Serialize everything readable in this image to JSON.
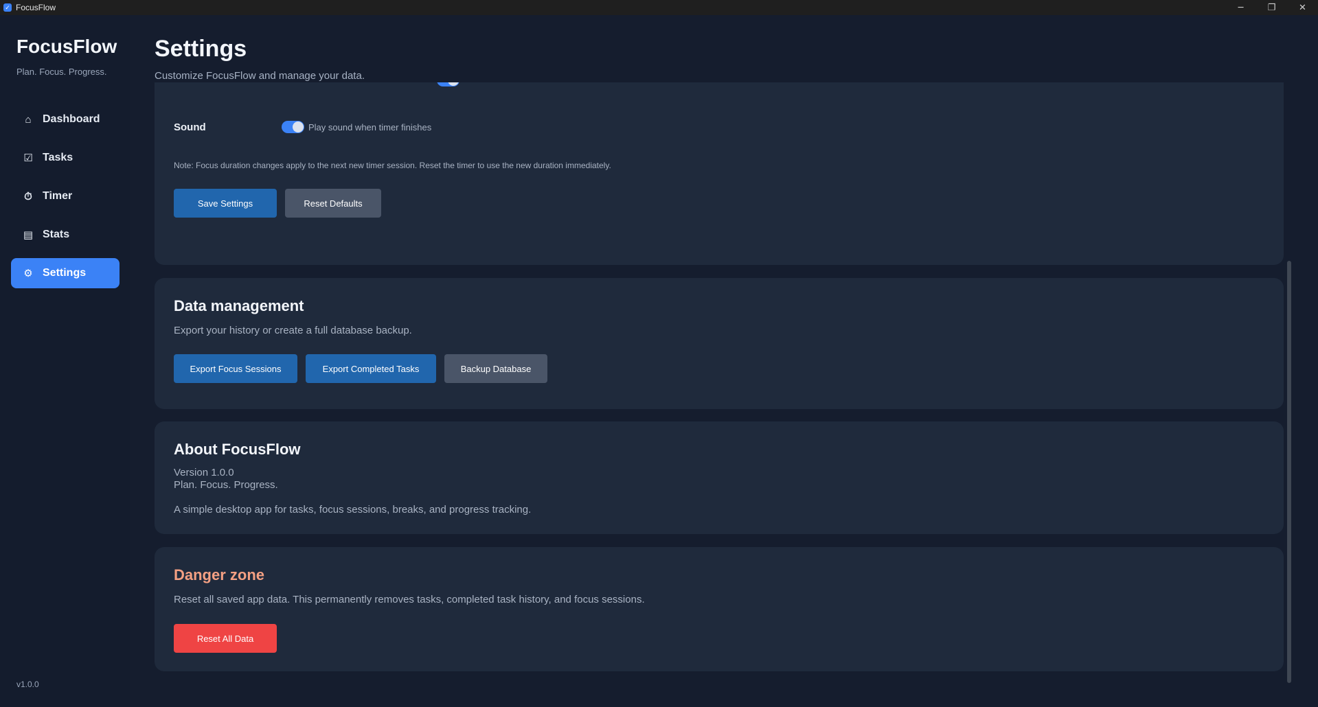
{
  "window": {
    "title": "FocusFlow",
    "controls": {
      "minimize": "─",
      "maximize": "❐",
      "close": "✕"
    }
  },
  "sidebar": {
    "brand": "FocusFlow",
    "tagline": "Plan. Focus. Progress.",
    "version": "v1.0.0",
    "items": [
      {
        "label": "Dashboard",
        "icon": "dashboard-icon",
        "glyph": "⌂",
        "active": false
      },
      {
        "label": "Tasks",
        "icon": "checkbox-icon",
        "glyph": "☑",
        "active": false
      },
      {
        "label": "Timer",
        "icon": "stopwatch-icon",
        "glyph": "⏱",
        "active": false
      },
      {
        "label": "Stats",
        "icon": "chart-icon",
        "glyph": "▤",
        "active": false
      },
      {
        "label": "Settings",
        "icon": "gear-icon",
        "glyph": "⚙",
        "active": true
      }
    ]
  },
  "header": {
    "title": "Settings",
    "subtitle": "Customize FocusFlow and manage your data."
  },
  "preferences": {
    "sound_label": "Sound",
    "sound_toggle_text": "Play sound when timer finishes",
    "sound_enabled": true,
    "note": "Note: Focus duration changes apply to the next new timer session. Reset the timer to use the new duration immediately.",
    "save_label": "Save Settings",
    "reset_label": "Reset Defaults"
  },
  "data_management": {
    "title": "Data management",
    "description": "Export your history or create a full database backup.",
    "export_sessions_label": "Export Focus Sessions",
    "export_tasks_label": "Export Completed Tasks",
    "backup_label": "Backup Database"
  },
  "about": {
    "title": "About FocusFlow",
    "version": "Version 1.0.0",
    "tagline": "Plan. Focus. Progress.",
    "description": "A simple desktop app for tasks, focus sessions, breaks, and progress tracking."
  },
  "danger": {
    "title": "Danger zone",
    "description": "Reset all saved app data. This permanently removes tasks, completed task history, and focus sessions.",
    "reset_all_label": "Reset All Data"
  },
  "colors": {
    "accent": "#3b82f6",
    "primary_button": "#2166ad",
    "secondary_button": "#4a5568",
    "danger_button": "#ef4444",
    "danger_title": "#f4a083",
    "card_bg": "#1f2a3c",
    "page_bg": "#151d2e"
  }
}
